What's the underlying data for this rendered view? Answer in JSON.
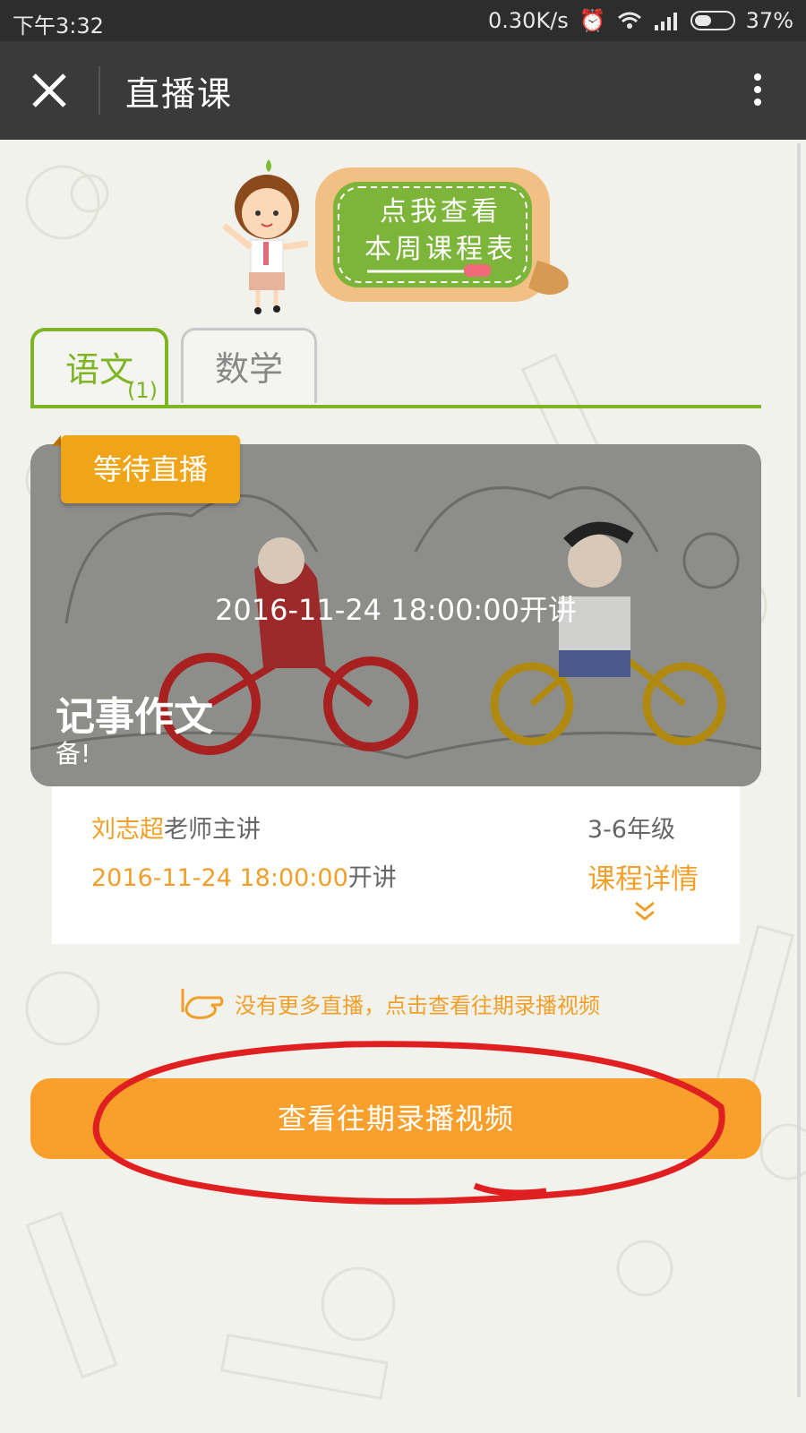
{
  "status_bar": {
    "time": "下午3:32",
    "speed": "0.30K/s",
    "battery": "37%"
  },
  "header": {
    "title": "直播课"
  },
  "schedule_banner": {
    "line1": "点我查看",
    "line2": "本周课程表"
  },
  "tabs": [
    {
      "label": "语文",
      "count": "(1)",
      "active": true
    },
    {
      "label": "数学",
      "active": false
    }
  ],
  "course": {
    "status": "等待直播",
    "start_overlay": "2016-11-24 18:00:00开讲",
    "title": "记事作文",
    "subtitle": "备!",
    "teacher_name": "刘志超",
    "teacher_suffix": "老师主讲",
    "grade": "3-6年级",
    "start_time": "2016-11-24 18:00:00",
    "start_suffix": "开讲",
    "detail_label": "课程详情"
  },
  "hint": "没有更多直播，点击查看往期录播视频",
  "replay_button": "查看往期录播视频",
  "colors": {
    "accent_orange": "#f8a02b",
    "tab_green": "#7fb524",
    "annotation_red": "#e02020"
  }
}
